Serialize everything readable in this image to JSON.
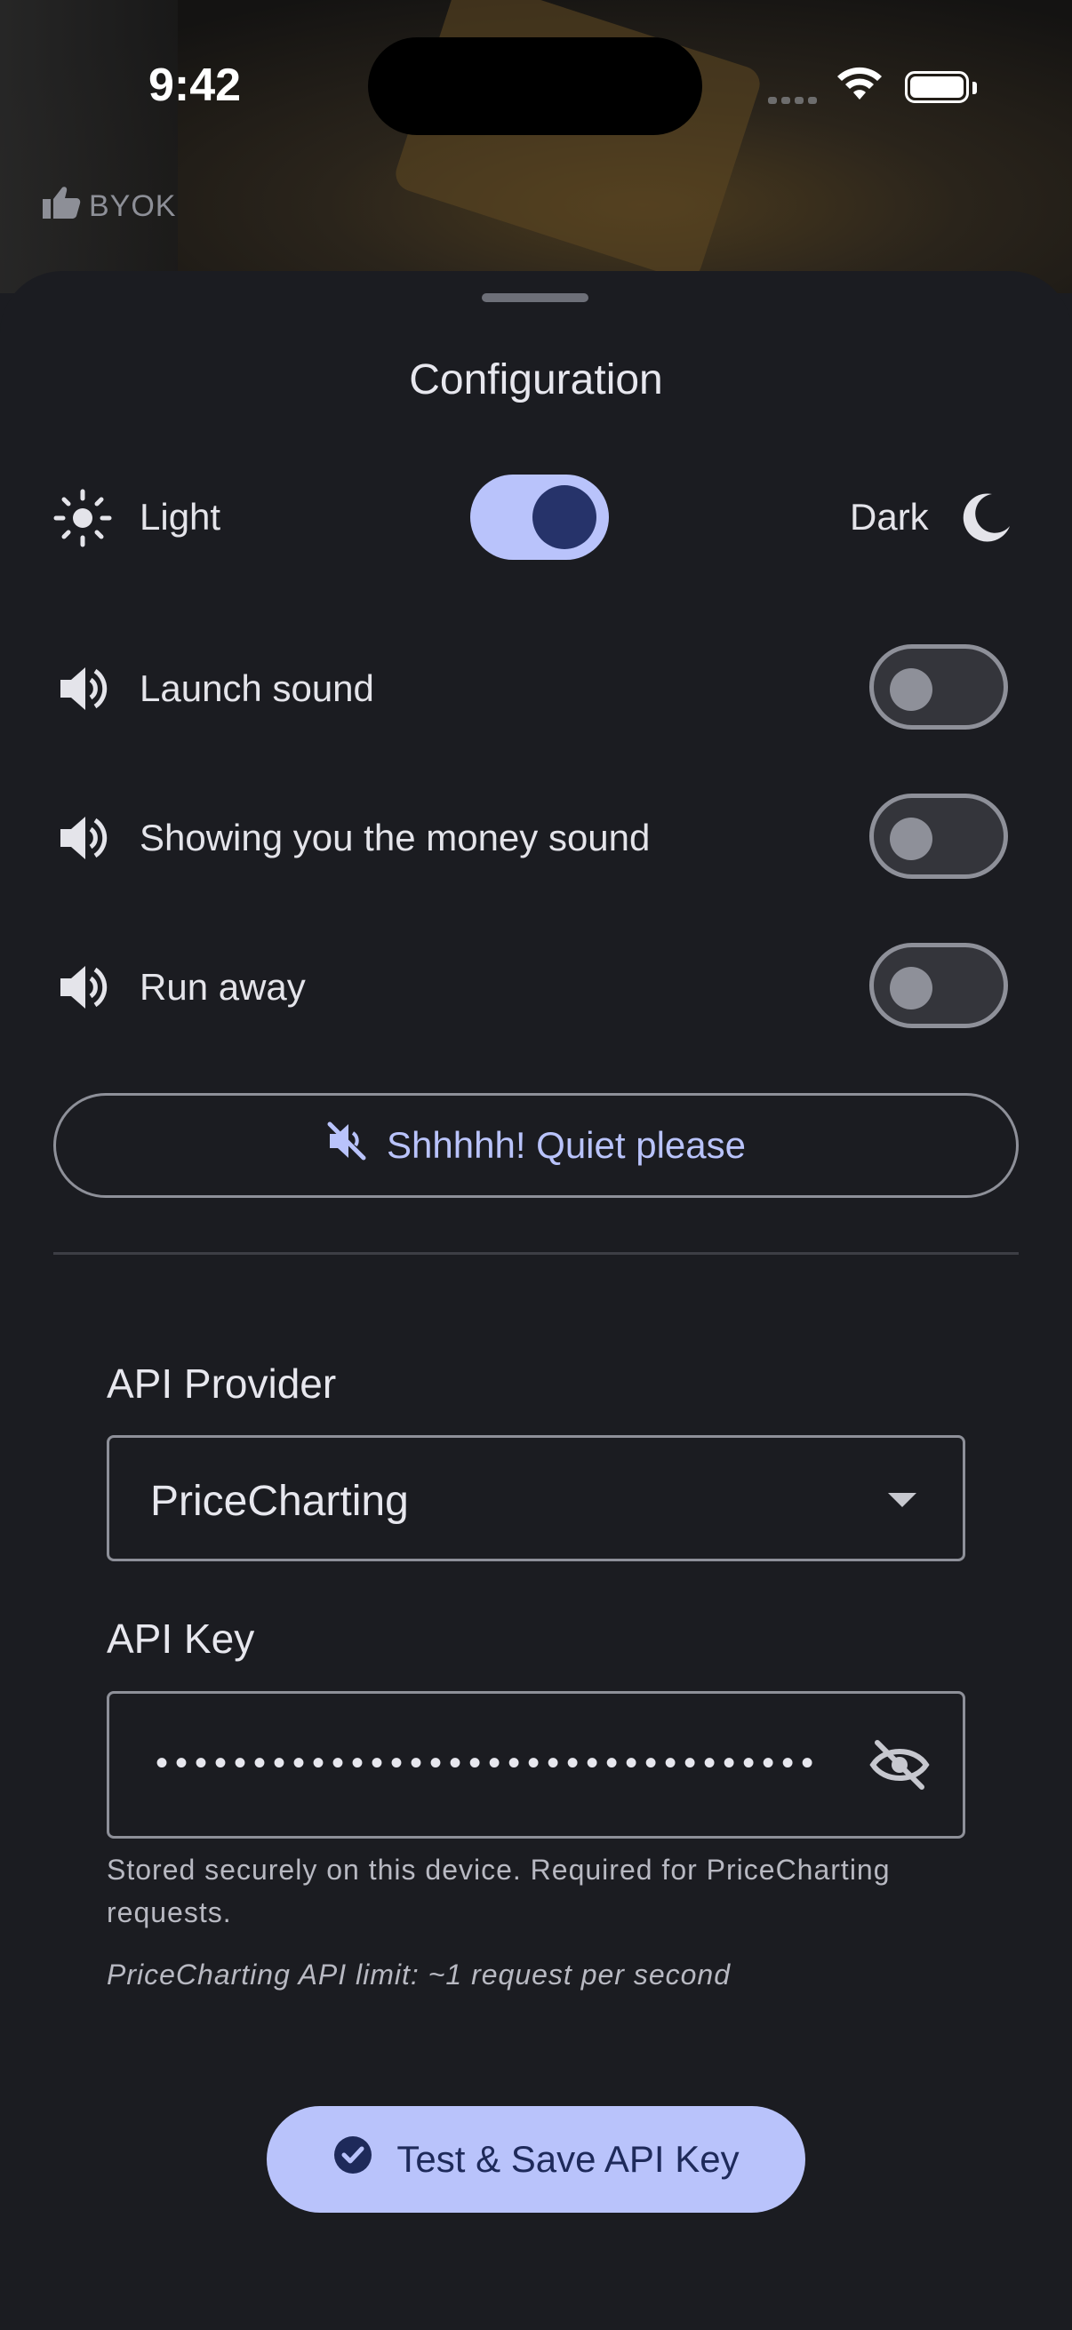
{
  "status": {
    "time": "9:42"
  },
  "header": {
    "badge": "BYOK"
  },
  "sheet": {
    "title": "Configuration",
    "theme": {
      "light_label": "Light",
      "dark_label": "Dark",
      "dark_enabled": true
    },
    "sounds": [
      {
        "label": "Launch sound",
        "enabled": false
      },
      {
        "label": "Showing you the money sound",
        "enabled": false
      },
      {
        "label": "Run away",
        "enabled": false
      }
    ],
    "quiet_button": "Shhhhh! Quiet please",
    "api_provider": {
      "label": "API Provider",
      "value": "PriceCharting"
    },
    "api_key": {
      "label": "API Key",
      "masked_value": "••••••••••••••••••••••••••••••••••",
      "helper": "Stored securely on this device. Required for PriceCharting requests.",
      "limit_note": "PriceCharting API limit: ~1 request per second"
    },
    "save_button": "Test & Save API Key"
  },
  "colors": {
    "accent": "#b9c3fb",
    "accent_dark": "#26336a",
    "background": "#1b1c21"
  }
}
